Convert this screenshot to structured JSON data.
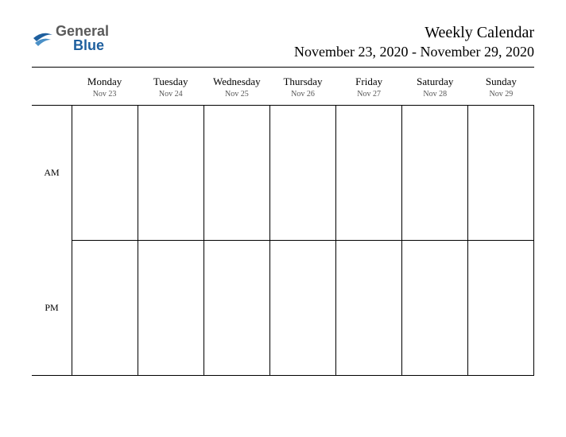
{
  "brand": {
    "word1": "General",
    "word2": "Blue"
  },
  "title": "Weekly Calendar",
  "date_range": "November 23, 2020 - November 29, 2020",
  "days": [
    {
      "name": "Monday",
      "date": "Nov 23"
    },
    {
      "name": "Tuesday",
      "date": "Nov 24"
    },
    {
      "name": "Wednesday",
      "date": "Nov 25"
    },
    {
      "name": "Thursday",
      "date": "Nov 26"
    },
    {
      "name": "Friday",
      "date": "Nov 27"
    },
    {
      "name": "Saturday",
      "date": "Nov 28"
    },
    {
      "name": "Sunday",
      "date": "Nov 29"
    }
  ],
  "periods": [
    "AM",
    "PM"
  ]
}
